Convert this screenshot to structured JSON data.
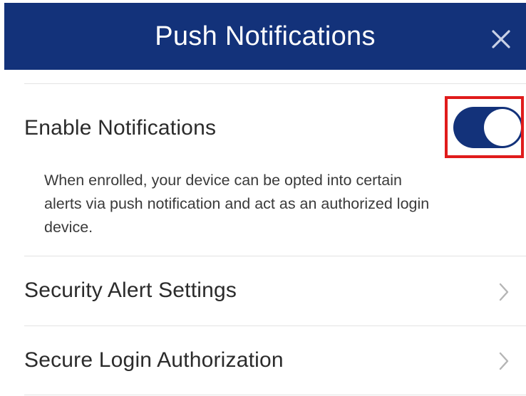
{
  "header": {
    "title": "Push Notifications"
  },
  "enable_notifications": {
    "label": "Enable Notifications",
    "enabled": true,
    "description": "When enrolled, your device can be opted into certain alerts via push notification and act as an authorized login device."
  },
  "menu": {
    "items": [
      {
        "label": "Security Alert Settings"
      },
      {
        "label": "Secure Login Authorization"
      }
    ]
  },
  "colors": {
    "brand": "#13327a",
    "highlight": "#e01b1b",
    "divider": "#e3e3e3",
    "chevron": "#b5b5b5"
  },
  "icons": {
    "close": "close-icon",
    "chevron": "chevron-right-icon"
  }
}
